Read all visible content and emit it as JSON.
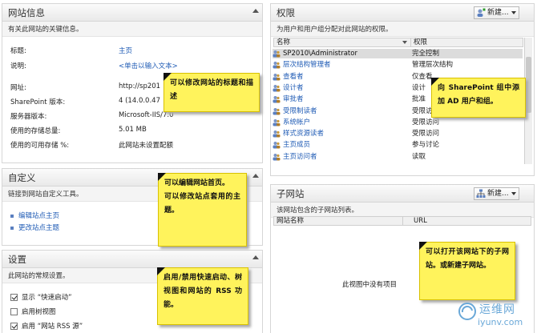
{
  "site_info": {
    "title": "网站信息",
    "description": "有关此网站的关键信息。",
    "rows": [
      {
        "label": "标题:",
        "value": "主页"
      },
      {
        "label": "说明:",
        "value": "<单击以输入文本>"
      },
      {
        "label": "网址:",
        "value": "http://sp201"
      },
      {
        "label": "SharePoint 版本:",
        "value": "4 (14.0.0.47"
      },
      {
        "label": "服务器版本:",
        "value": "Microsoft-IIS/7.0"
      },
      {
        "label": "使用的存储总量:",
        "value": "5.01 MB"
      },
      {
        "label": "使用的可用存储 %:",
        "value": "此网站未设置配额"
      }
    ]
  },
  "customize": {
    "title": "自定义",
    "description": "链接到网站自定义工具。",
    "links": [
      "编辑站点主页",
      "更改站点主题"
    ]
  },
  "settings": {
    "title": "设置",
    "description": "此网站的常规设置。",
    "options": [
      {
        "label": "显示 “快速启动”",
        "checked": true
      },
      {
        "label": "启用树视图",
        "checked": false
      },
      {
        "label": "启用 “网站 RSS 源”",
        "checked": true
      }
    ]
  },
  "permissions": {
    "title": "权限",
    "new_label": "新建...",
    "description": "为用户和用户组分配对此网站的权限。",
    "col_name": "名称",
    "col_perm": "权限",
    "rows": [
      {
        "name": "SP2010\\Administrator",
        "perm": "完全控制",
        "selected": true
      },
      {
        "name": "层次结构管理者",
        "perm": "管理层次结构"
      },
      {
        "name": "查看者",
        "perm": "仅查看"
      },
      {
        "name": "设计者",
        "perm": "设计"
      },
      {
        "name": "审批者",
        "perm": "批准"
      },
      {
        "name": "受限制读者",
        "perm": "受限访问"
      },
      {
        "name": "系统帐户",
        "perm": "受限访问"
      },
      {
        "name": "样式资源读者",
        "perm": "受限访问"
      },
      {
        "name": "主页成员",
        "perm": "参与讨论"
      },
      {
        "name": "主页访问者",
        "perm": "读取"
      }
    ]
  },
  "subsites": {
    "title": "子网站",
    "new_label": "新建...",
    "description": "该网站包含的子网站列表。",
    "col_name": "网站名称",
    "col_url": "URL",
    "empty_text": "此视图中没有项目"
  },
  "notes": {
    "site_info": "可以修改网站的标题和描述",
    "permissions": "向 SharePoint 组中添加 AD 用户和组。",
    "customize_a": "可以编辑网站首页。",
    "customize_b": "可以修改站点套用的主题。",
    "settings": "启用/禁用快速启动、树视图和网站的 RSS 功能。",
    "subsites": "可以打开该网站下的子网站。或新建子网站。"
  },
  "watermark": {
    "text": "运维网",
    "url": "iyunv.com"
  }
}
